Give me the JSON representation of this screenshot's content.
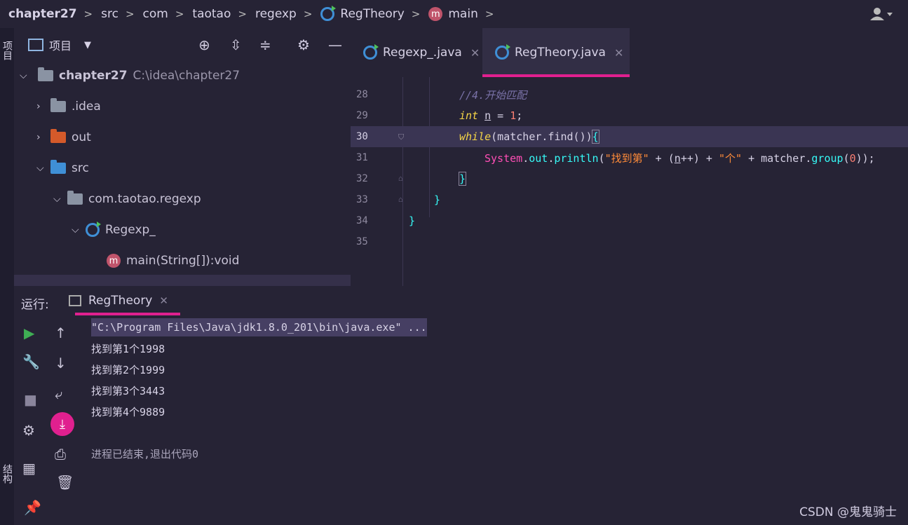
{
  "breadcrumb": {
    "items": [
      "chapter27",
      "src",
      "com",
      "taotao",
      "regexp",
      "RegTheory",
      "main"
    ],
    "separator": ">",
    "icons": {
      "class": "class-icon",
      "method": "method-icon"
    }
  },
  "left_strip": {
    "top_label": "项目",
    "bottom_label": "结构"
  },
  "project": {
    "title": "项目",
    "tree": [
      {
        "label": "chapter27",
        "path": "C:\\idea\\chapter27",
        "expanded": true
      },
      {
        "label": ".idea",
        "expanded": false
      },
      {
        "label": "out",
        "expanded": false
      },
      {
        "label": "src",
        "expanded": true
      },
      {
        "label": "com.taotao.regexp",
        "expanded": true
      },
      {
        "label": "Regexp_",
        "expanded": true
      },
      {
        "label": "main(String[]):void"
      }
    ]
  },
  "editor": {
    "tabs": [
      {
        "label": "Regexp_.java",
        "active": false
      },
      {
        "label": "RegTheory.java",
        "active": true
      }
    ],
    "line_numbers": [
      "28",
      "29",
      "30",
      "31",
      "32",
      "33",
      "34",
      "35"
    ],
    "code": {
      "l28": "//4.开始匹配",
      "l29_kw": "int",
      "l29_var": "n",
      "l29_eq": " = ",
      "l29_num": "1",
      "l29_end": ";",
      "l30_kw": "while",
      "l30_rest": "(matcher.find())",
      "l30_brace": "{",
      "l31_cls": "System",
      "l31_dot1": ".",
      "l31_fld": "out",
      "l31_dot2": ".",
      "l31_fn": "println",
      "l31_open": "(",
      "l31_str1": "\"找到第\"",
      "l31_plus1": " + (",
      "l31_var": "n",
      "l31_inc": "++) + ",
      "l31_str2": "\"个\"",
      "l31_plus2": " + matcher.",
      "l31_fn2": "group",
      "l31_arg_open": "(",
      "l31_num": "0",
      "l31_end": "));",
      "l32": "}",
      "l33": "}",
      "l34": "}"
    },
    "colors": {
      "keyword": "#f5d547",
      "comment": "#7a72a8",
      "number": "#f97e72",
      "string": "#ff8b39",
      "accent": "#e0208f"
    }
  },
  "run": {
    "label": "运行:",
    "tab": "RegTheory",
    "output": [
      "\"C:\\Program Files\\Java\\jdk1.8.0_201\\bin\\java.exe\" ...",
      "找到第1个1998",
      "找到第2个1999",
      "找到第3个3443",
      "找到第4个9889",
      "",
      "进程已结束,退出代码0"
    ]
  },
  "watermark": "CSDN @鬼鬼骑士"
}
